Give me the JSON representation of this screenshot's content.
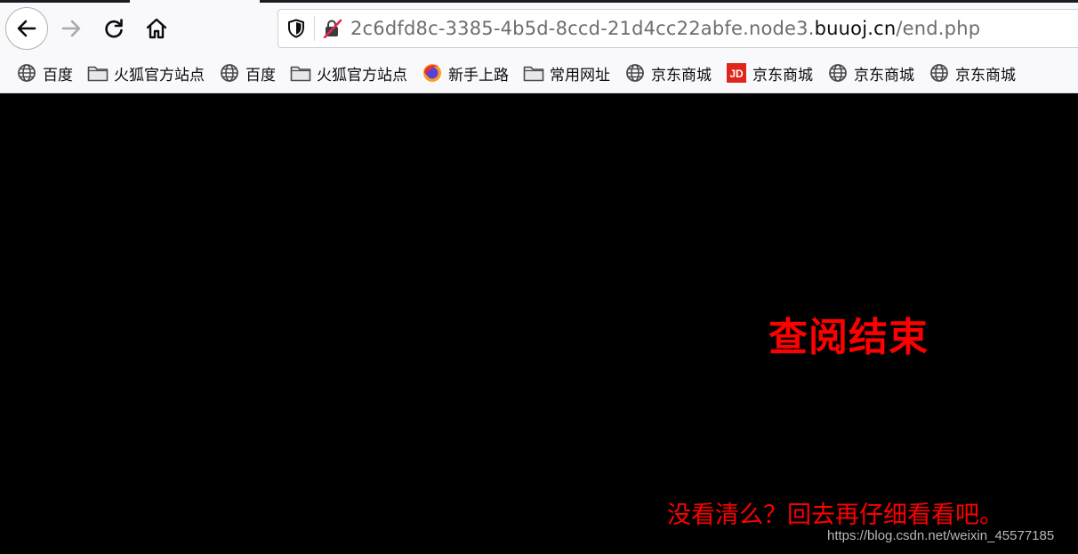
{
  "toolbar": {
    "back_icon": "arrow-left-icon",
    "forward_icon": "arrow-right-icon",
    "reload_icon": "reload-icon",
    "home_icon": "home-icon"
  },
  "urlbar": {
    "prefix": "2c6dfd8c-3385-4b5d-8ccd-21d4cc22abfe.node3.",
    "host": "buuoj.cn",
    "path": "/end.php"
  },
  "bookmarks": [
    {
      "label": "百度",
      "icon": "globe-icon"
    },
    {
      "label": "火狐官方站点",
      "icon": "folder-icon"
    },
    {
      "label": "百度",
      "icon": "globe-icon"
    },
    {
      "label": "火狐官方站点",
      "icon": "folder-icon"
    },
    {
      "label": "新手上路",
      "icon": "firefox-icon"
    },
    {
      "label": "常用网址",
      "icon": "folder-icon"
    },
    {
      "label": "京东商城",
      "icon": "globe-icon"
    },
    {
      "label": "京东商城",
      "icon": "jd-icon"
    },
    {
      "label": "京东商城",
      "icon": "globe-icon"
    },
    {
      "label": "京东商城",
      "icon": "globe-icon"
    }
  ],
  "page": {
    "title": "查阅结束",
    "hint": "没看清么？回去再仔细看看吧。",
    "watermark": "https://blog.csdn.net/weixin_45577185"
  },
  "colors": {
    "page_background": "#000000",
    "text_red": "#ff0000"
  }
}
